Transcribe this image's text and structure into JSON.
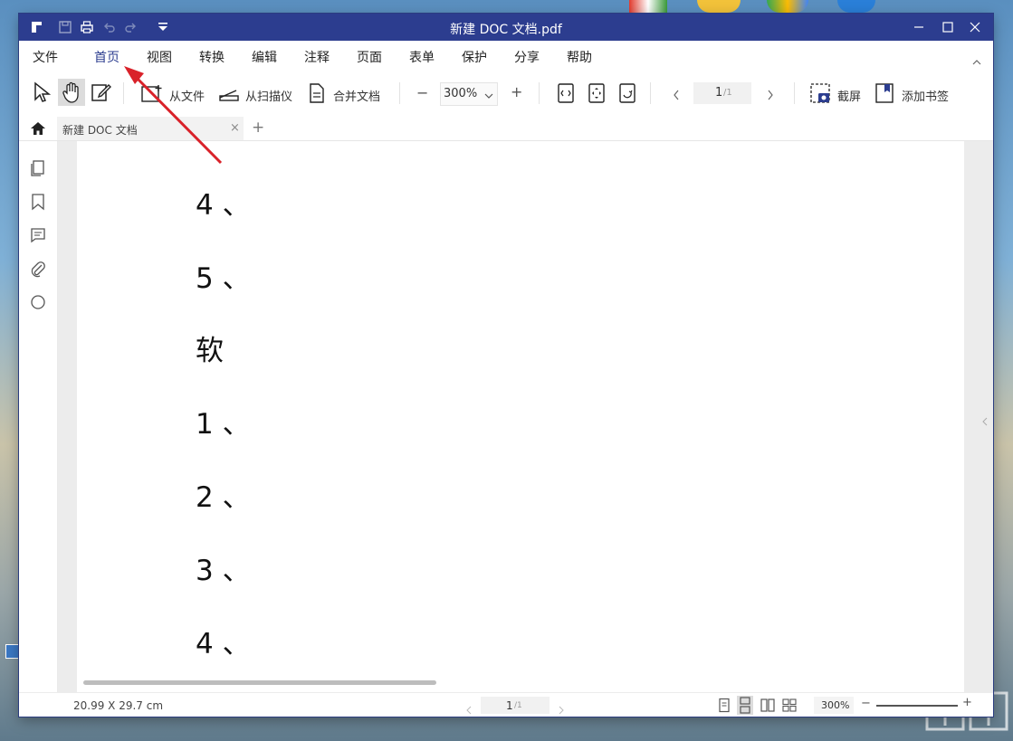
{
  "window": {
    "title": "新建 DOC 文档.pdf"
  },
  "menu": {
    "items": [
      "文件",
      "首页",
      "视图",
      "转换",
      "编辑",
      "注释",
      "页面",
      "表单",
      "保护",
      "分享",
      "帮助"
    ],
    "active": "首页"
  },
  "toolbar": {
    "from_file": "从文件",
    "from_scanner": "从扫描仪",
    "merge_docs": "合并文档",
    "zoom_minus": "−",
    "zoom_value": "300%",
    "zoom_plus": "+",
    "page_current": "1",
    "page_total": "/1",
    "screenshot": "截屏",
    "add_bookmark": "添加书签"
  },
  "tabs": {
    "doc_tab_label": "新建 DOC 文档",
    "close_glyph": "×",
    "add_glyph": "+"
  },
  "document": {
    "lines": [
      "4 、",
      "5 、",
      "软",
      "1 、",
      "2 、",
      "3 、",
      "4 、"
    ]
  },
  "statusbar": {
    "page_size": "20.99 X 29.7 cm",
    "page_current": "1",
    "page_total": "/1",
    "zoom": "300%",
    "zoom_minus": "−",
    "zoom_plus": "+"
  },
  "colors": {
    "title_bar": "#2c3d8f",
    "accent": "#2c3d8f",
    "annotation_arrow": "#d9222a"
  }
}
